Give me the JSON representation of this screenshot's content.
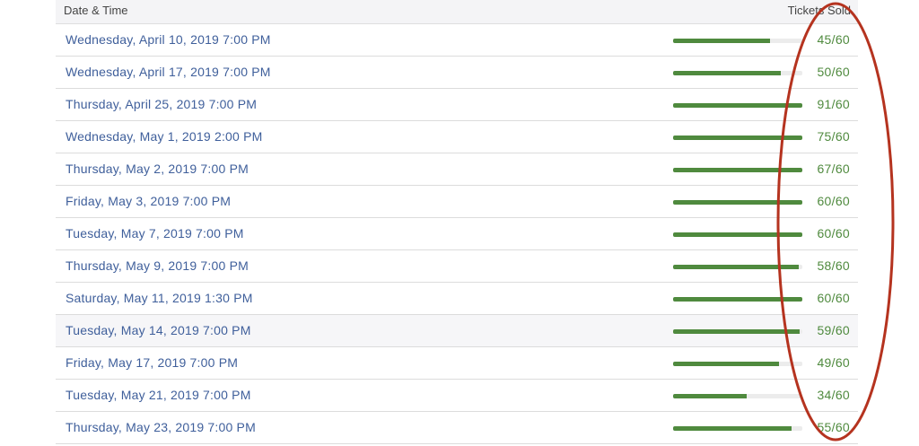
{
  "header": {
    "date_label": "Date & Time",
    "tickets_label": "Tickets Sold"
  },
  "colors": {
    "link": "#3f5f9b",
    "bar": "#4f8a3e",
    "annotation": "#b5331f"
  },
  "rows": [
    {
      "date": "Wednesday, April 10, 2019 7:00 PM",
      "count": "45/60",
      "fill": 0.75
    },
    {
      "date": "Wednesday, April 17, 2019 7:00 PM",
      "count": "50/60",
      "fill": 0.83
    },
    {
      "date": "Thursday, April 25, 2019 7:00 PM",
      "count": "91/60",
      "fill": 1.0
    },
    {
      "date": "Wednesday, May 1, 2019 2:00 PM",
      "count": "75/60",
      "fill": 1.0
    },
    {
      "date": "Thursday, May 2, 2019 7:00 PM",
      "count": "67/60",
      "fill": 1.0
    },
    {
      "date": "Friday, May 3, 2019 7:00 PM",
      "count": "60/60",
      "fill": 1.0
    },
    {
      "date": "Tuesday, May 7, 2019 7:00 PM",
      "count": "60/60",
      "fill": 1.0
    },
    {
      "date": "Thursday, May 9, 2019 7:00 PM",
      "count": "58/60",
      "fill": 0.97
    },
    {
      "date": "Saturday, May 11, 2019 1:30 PM",
      "count": "60/60",
      "fill": 1.0
    },
    {
      "date": "Tuesday, May 14, 2019 7:00 PM",
      "count": "59/60",
      "fill": 0.98
    },
    {
      "date": "Friday, May 17, 2019 7:00 PM",
      "count": "49/60",
      "fill": 0.82
    },
    {
      "date": "Tuesday, May 21, 2019 7:00 PM",
      "count": "34/60",
      "fill": 0.57
    },
    {
      "date": "Thursday, May 23, 2019 7:00 PM",
      "count": "55/60",
      "fill": 0.92
    }
  ]
}
